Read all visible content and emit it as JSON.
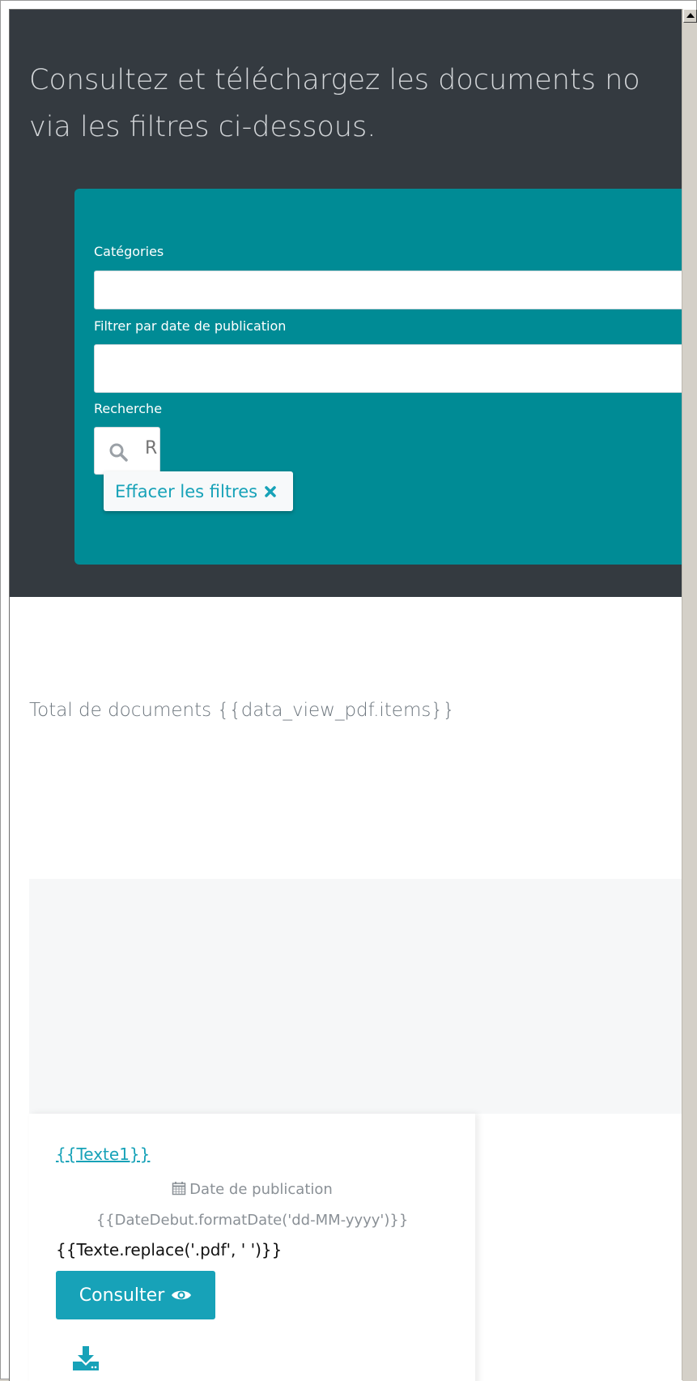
{
  "hero": {
    "line1": "Consultez et téléchargez les documents no",
    "line2": "via les filtres ci-dessous."
  },
  "filters": {
    "categories_label": "Catégories",
    "date_label": "Filtrer par date de publication",
    "search_label": "Recherche",
    "search_placeholder": "R",
    "clear_label": "Effacer les filtres"
  },
  "total": {
    "text": "Total de documents {{data_view_pdf.items}}"
  },
  "card": {
    "link": "{{Texte1}}",
    "date_label": "Date de publication",
    "date_value": "{{DateDebut.formatDate('dd-MM-yyyy')}}",
    "texte": "{{Texte.replace('.pdf', ' ')}}",
    "consult_label": "Consulter"
  },
  "icons": {
    "search": "search-icon",
    "clear": "close-icon",
    "calendar": "calendar-icon",
    "view": "eye-icon",
    "download": "download-icon",
    "scroll_up": "arrow-up-icon"
  },
  "colors": {
    "hero_bg": "#343a40",
    "panel_bg": "#008b95",
    "accent": "#17a2b8",
    "card_top_bg": "#f6f7f8"
  }
}
